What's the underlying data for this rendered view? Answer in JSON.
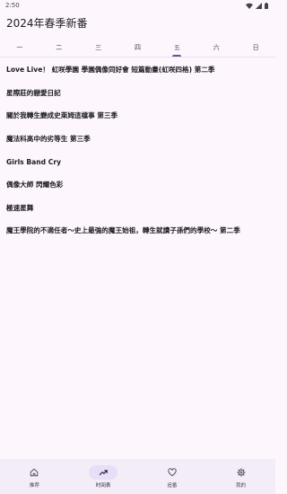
{
  "status_bar": {
    "time": "2:50"
  },
  "app_bar": {
    "title": "2024年春季新番"
  },
  "tabs": [
    {
      "label": "一",
      "active": false
    },
    {
      "label": "二",
      "active": false
    },
    {
      "label": "三",
      "active": false
    },
    {
      "label": "四",
      "active": false
    },
    {
      "label": "五",
      "active": true
    },
    {
      "label": "六",
      "active": false
    },
    {
      "label": "日",
      "active": false
    }
  ],
  "anime_list": [
    "Love Live！ 虹咲學園 學園偶像同好會 短篇動畫(虹咲四格) 第二季",
    "星際莊的戀愛日記",
    "關於我轉生變成史萊姆這檔事 第三季",
    "魔法科高中的劣等生 第三季",
    "Girls Band Cry",
    "偶像大師 閃耀色彩",
    "極速星舞",
    "魔王學院的不適任者～史上最強的魔王始祖，轉生就讀子孫們的學校～ 第二季"
  ],
  "bottom_nav": [
    {
      "label": "推荐",
      "icon": "home-icon",
      "active": false
    },
    {
      "label": "时间表",
      "icon": "trending-icon",
      "active": true
    },
    {
      "label": "追番",
      "icon": "heart-icon",
      "active": false
    },
    {
      "label": "我的",
      "icon": "settings-icon",
      "active": false
    }
  ],
  "colors": {
    "accent": "#65558f",
    "background": "#fdf7fd",
    "nav_background": "#f3edf7",
    "active_pill": "#e8def8"
  }
}
